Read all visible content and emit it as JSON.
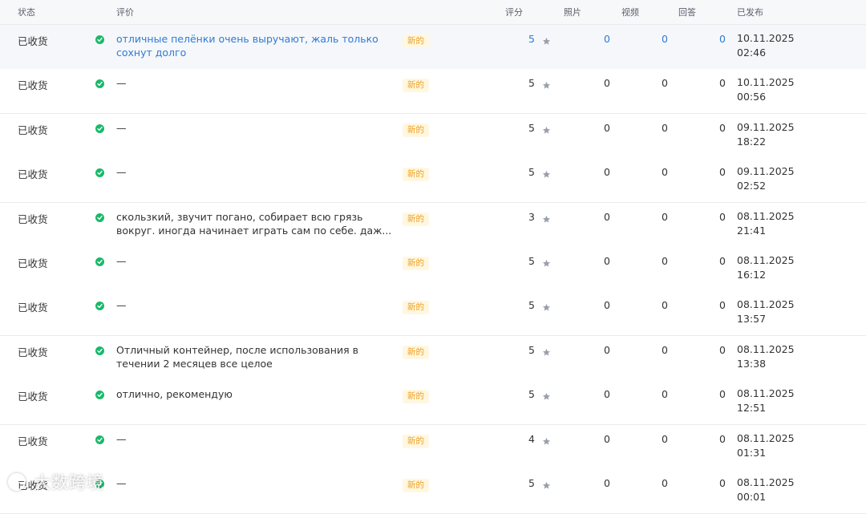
{
  "columns": {
    "status": "状态",
    "review": "评价",
    "rating": "评分",
    "photos": "照片",
    "videos": "视频",
    "replies": "回答",
    "published": "已发布"
  },
  "colors": {
    "accent": "#2f7bd6",
    "success": "#19b96a",
    "badge_text": "#f0a020",
    "badge_bg": "#fff7e0"
  },
  "rows": [
    {
      "status": "已收货",
      "review": "отличные пелёнки очень выручают, жаль только сохнут долго",
      "badge": "新的",
      "rating": "5",
      "photos": "0",
      "videos": "0",
      "replies": "0",
      "date": "10.11.2025",
      "time": "02:46"
    },
    {
      "status": "已收货",
      "review": "—",
      "badge": "新的",
      "rating": "5",
      "photos": "0",
      "videos": "0",
      "replies": "0",
      "date": "10.11.2025",
      "time": "00:56"
    },
    {
      "status": "已收货",
      "review": "—",
      "badge": "新的",
      "rating": "5",
      "photos": "0",
      "videos": "0",
      "replies": "0",
      "date": "09.11.2025",
      "time": "18:22"
    },
    {
      "status": "已收货",
      "review": "—",
      "badge": "新的",
      "rating": "5",
      "photos": "0",
      "videos": "0",
      "replies": "0",
      "date": "09.11.2025",
      "time": "02:52"
    },
    {
      "status": "已收货",
      "review": "скользкий, звучит погано, собирает всю грязь вокруг. иногда начинает играть сам по себе. даж...",
      "badge": "新的",
      "rating": "3",
      "photos": "0",
      "videos": "0",
      "replies": "0",
      "date": "08.11.2025",
      "time": "21:41"
    },
    {
      "status": "已收货",
      "review": "—",
      "badge": "新的",
      "rating": "5",
      "photos": "0",
      "videos": "0",
      "replies": "0",
      "date": "08.11.2025",
      "time": "16:12"
    },
    {
      "status": "已收货",
      "review": "—",
      "badge": "新的",
      "rating": "5",
      "photos": "0",
      "videos": "0",
      "replies": "0",
      "date": "08.11.2025",
      "time": "13:57"
    },
    {
      "status": "已收货",
      "review": "Отличный контейнер, после использования в течении 2 месяцев все целое",
      "badge": "新的",
      "rating": "5",
      "photos": "0",
      "videos": "0",
      "replies": "0",
      "date": "08.11.2025",
      "time": "13:38"
    },
    {
      "status": "已收货",
      "review": "отлично, рекомендую",
      "badge": "新的",
      "rating": "5",
      "photos": "0",
      "videos": "0",
      "replies": "0",
      "date": "08.11.2025",
      "time": "12:51"
    },
    {
      "status": "已收货",
      "review": "—",
      "badge": "新的",
      "rating": "4",
      "photos": "0",
      "videos": "0",
      "replies": "0",
      "date": "08.11.2025",
      "time": "01:31"
    },
    {
      "status": "已收货",
      "review": "—",
      "badge": "新的",
      "rating": "5",
      "photos": "0",
      "videos": "0",
      "replies": "0",
      "date": "08.11.2025",
      "time": "00:01"
    }
  ],
  "watermark": "大数跨境"
}
